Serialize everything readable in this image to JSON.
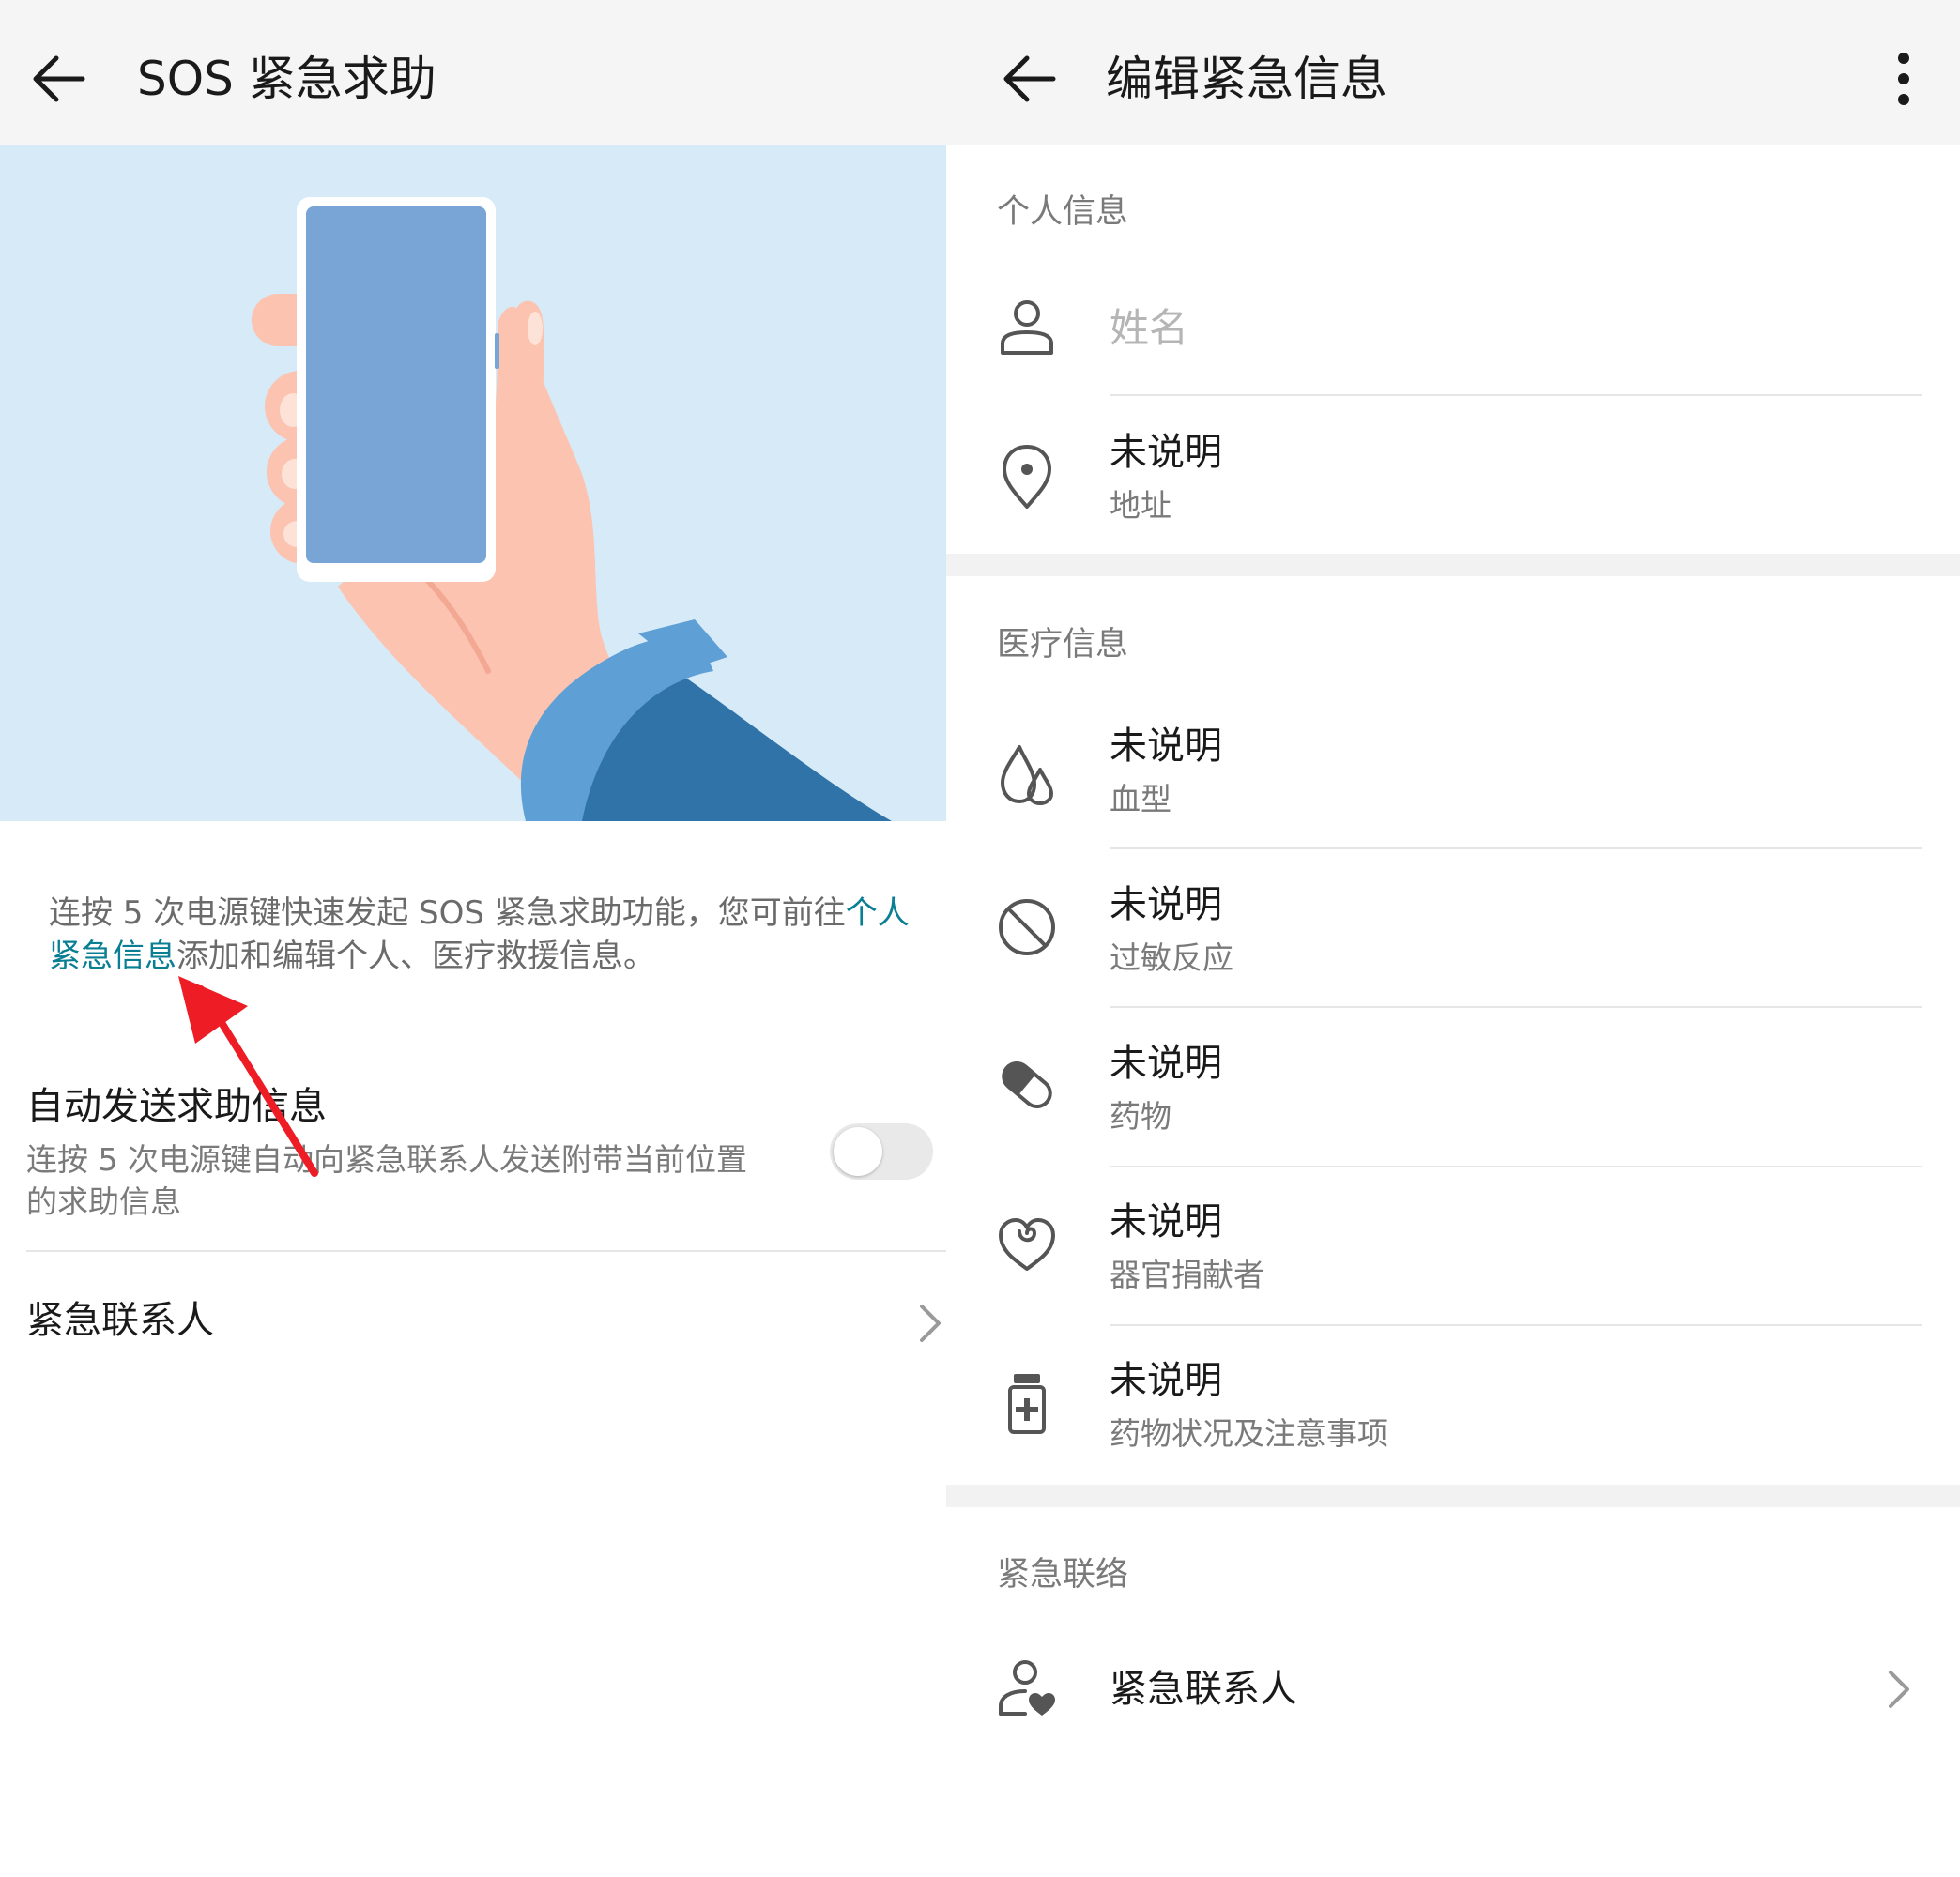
{
  "left": {
    "header": {
      "title": "SOS 紧急求助"
    },
    "description": {
      "text_before": "连按 5 次电源键快速发起 SOS 紧急求助功能，您可前往",
      "link": "个人紧急信息",
      "text_after": "添加和编辑个人、医疗救援信息。"
    },
    "auto_send": {
      "title": "自动发送求助信息",
      "subtitle": "连按 5 次电源键自动向紧急联系人发送附带当前位置的求助信息",
      "enabled": false
    },
    "emergency_contacts": {
      "label": "紧急联系人"
    },
    "colors": {
      "link": "#0a7f94",
      "hero_bg": "#d7eaf8",
      "annotation_arrow": "#ee1c24"
    }
  },
  "right": {
    "header": {
      "title": "编辑紧急信息"
    },
    "personal": {
      "heading": "个人信息",
      "name_placeholder": "姓名",
      "address": {
        "value": "未说明",
        "label": "地址"
      }
    },
    "medical": {
      "heading": "医疗信息",
      "items": [
        {
          "value": "未说明",
          "label": "血型",
          "icon": "blood-drop-icon"
        },
        {
          "value": "未说明",
          "label": "过敏反应",
          "icon": "prohibited-icon"
        },
        {
          "value": "未说明",
          "label": "药物",
          "icon": "pill-icon"
        },
        {
          "value": "未说明",
          "label": "器官捐献者",
          "icon": "heart-ribbon-icon"
        },
        {
          "value": "未说明",
          "label": "药物状况及注意事项",
          "icon": "medicine-bottle-icon"
        }
      ]
    },
    "emergency": {
      "heading": "紧急联络",
      "contacts_label": "紧急联系人"
    }
  }
}
